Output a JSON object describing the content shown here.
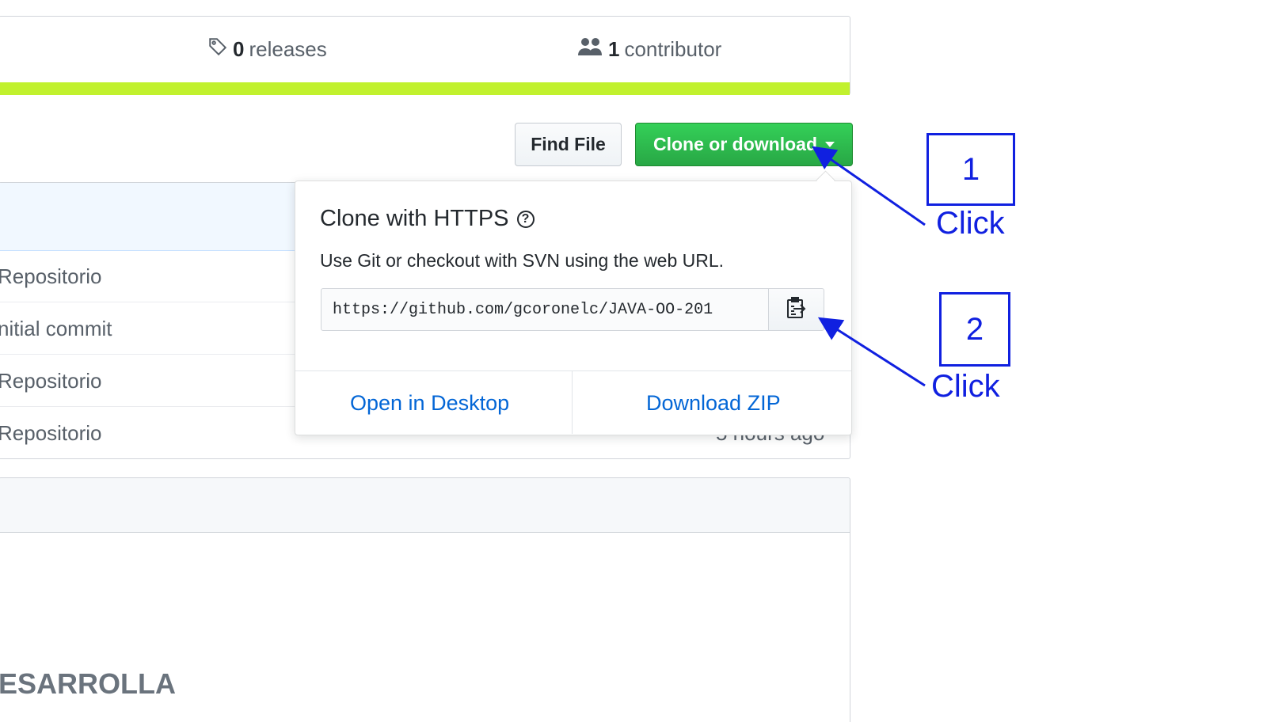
{
  "stats": {
    "releases_count": "0",
    "releases_label": "releases",
    "contributors_count": "1",
    "contributors_label": "contributor"
  },
  "actions": {
    "find_file": "Find File",
    "clone_or_download": "Clone or download"
  },
  "files": [
    {
      "message": "Repositorio",
      "age": ""
    },
    {
      "message": "nitial commit",
      "age": ""
    },
    {
      "message": "Repositorio",
      "age": ""
    },
    {
      "message": "Repositorio",
      "age": "5 hours ago"
    }
  ],
  "readme": {
    "text": "ESARROLLA"
  },
  "clone_dropdown": {
    "title": "Clone with HTTPS",
    "description": "Use Git or checkout with SVN using the web URL.",
    "url": "https://github.com/gcoronelc/JAVA-OO-201",
    "open_desktop": "Open in Desktop",
    "download_zip": "Download ZIP"
  },
  "annotations": [
    {
      "number": "1",
      "label": "Click"
    },
    {
      "number": "2",
      "label": "Click"
    }
  ],
  "colors": {
    "language_bar": "#c1f12e",
    "clone_button": "#28a745",
    "link": "#0366d6",
    "annotation": "#1020e0"
  },
  "icons": {
    "releases": "tag-icon",
    "contributors": "people-icon",
    "help": "question-icon",
    "copy": "clipboard-icon",
    "clone_caret": "caret-down-icon"
  }
}
